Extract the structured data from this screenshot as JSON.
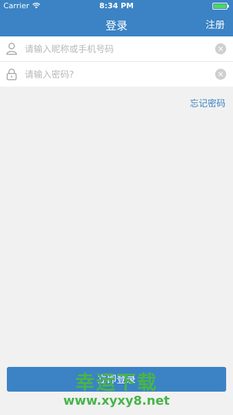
{
  "status_bar": {
    "carrier": "Carrier",
    "time": "8:34 PM"
  },
  "nav": {
    "title": "登录",
    "register": "注册"
  },
  "form": {
    "username": {
      "placeholder": "请输入昵称或手机号码",
      "value": ""
    },
    "password": {
      "placeholder": "请输入密码?",
      "value": ""
    }
  },
  "links": {
    "forgot_password": "忘记密码"
  },
  "actions": {
    "login": "立即登录"
  },
  "watermark": {
    "text": "幸运下载",
    "url": "www.xyxy8.net"
  },
  "colors": {
    "primary": "#3b83c4",
    "background": "#f1f1f1",
    "watermark": "#48b44a"
  }
}
